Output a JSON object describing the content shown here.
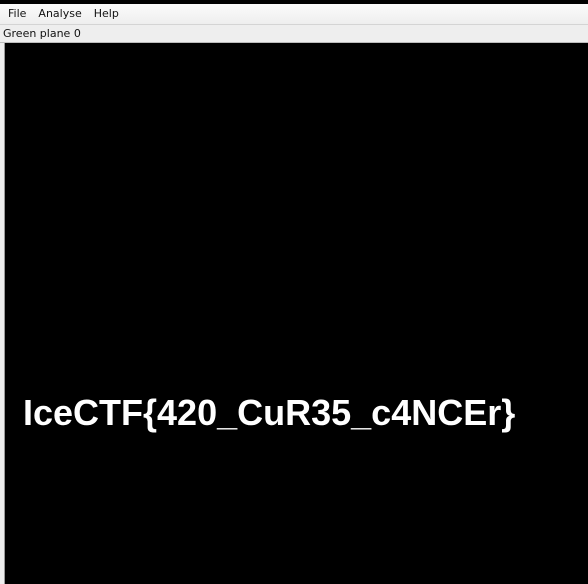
{
  "menubar": {
    "items": [
      "File",
      "Analyse",
      "Help"
    ]
  },
  "status": {
    "label": "Green plane 0"
  },
  "image": {
    "text": "IceCTF{420_CuR35_c4NCEr}",
    "background_color": "#000000",
    "text_color": "#ffffff"
  }
}
